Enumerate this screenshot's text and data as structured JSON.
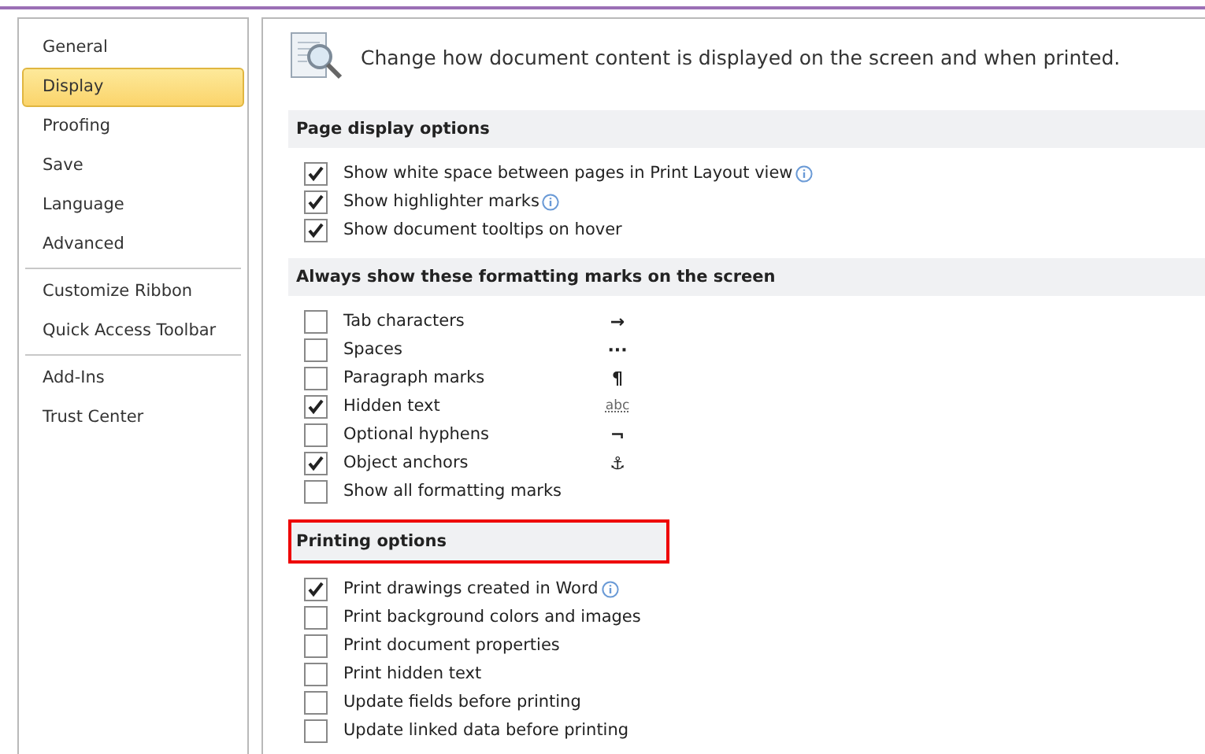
{
  "sidebar": {
    "groups": [
      [
        {
          "label": "General",
          "selected": false
        },
        {
          "label": "Display",
          "selected": true
        },
        {
          "label": "Proofing",
          "selected": false
        },
        {
          "label": "Save",
          "selected": false
        },
        {
          "label": "Language",
          "selected": false
        },
        {
          "label": "Advanced",
          "selected": false
        }
      ],
      [
        {
          "label": "Customize Ribbon",
          "selected": false
        },
        {
          "label": "Quick Access Toolbar",
          "selected": false
        }
      ],
      [
        {
          "label": "Add-Ins",
          "selected": false
        },
        {
          "label": "Trust Center",
          "selected": false
        }
      ]
    ]
  },
  "header": {
    "text": "Change how document content is displayed on the screen and when printed."
  },
  "sections": [
    {
      "title": "Page display options",
      "highlighted": false,
      "options": [
        {
          "label": "Show white space between pages in Print Layout view",
          "checked": true,
          "kind": "info"
        },
        {
          "label": "Show highlighter marks",
          "checked": true,
          "kind": "info"
        },
        {
          "label": "Show document tooltips on hover",
          "checked": true,
          "kind": "plain"
        }
      ]
    },
    {
      "title": "Always show these formatting marks on the screen",
      "highlighted": false,
      "options": [
        {
          "label": "Tab characters",
          "checked": false,
          "mark": "→",
          "kind": "arrow"
        },
        {
          "label": "Spaces",
          "checked": false,
          "mark": "···",
          "kind": "dots"
        },
        {
          "label": "Paragraph marks",
          "checked": false,
          "mark": "¶",
          "kind": "pilcrow"
        },
        {
          "label": "Hidden text",
          "checked": true,
          "mark": "abc",
          "kind": "hidden"
        },
        {
          "label": "Optional hyphens",
          "checked": false,
          "mark": "¬",
          "kind": "hyphen"
        },
        {
          "label": "Object anchors",
          "checked": true,
          "mark": "⚓",
          "kind": "anchor"
        },
        {
          "label": "Show all formatting marks",
          "checked": false,
          "kind": "plain"
        }
      ]
    },
    {
      "title": "Printing options",
      "highlighted": true,
      "options": [
        {
          "label": "Print drawings created in Word",
          "checked": true,
          "kind": "info"
        },
        {
          "label": "Print background colors and images",
          "checked": false,
          "kind": "plain"
        },
        {
          "label": "Print document properties",
          "checked": false,
          "kind": "plain"
        },
        {
          "label": "Print hidden text",
          "checked": false,
          "kind": "plain"
        },
        {
          "label": "Update fields before printing",
          "checked": false,
          "kind": "plain"
        },
        {
          "label": "Update linked data before printing",
          "checked": false,
          "kind": "plain"
        }
      ]
    }
  ]
}
